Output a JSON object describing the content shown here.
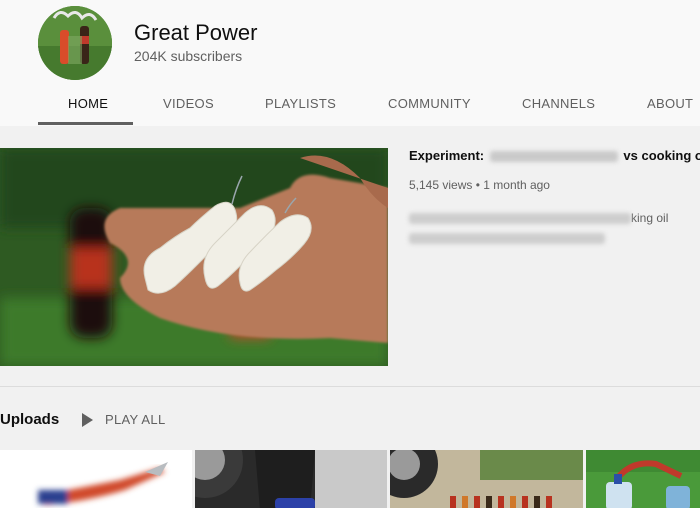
{
  "channel": {
    "name": "Great Power",
    "subscribers": "204K subscribers"
  },
  "tabs": [
    "HOME",
    "VIDEOS",
    "PLAYLISTS",
    "COMMUNITY",
    "CHANNELS",
    "ABOUT"
  ],
  "active_tab": "HOME",
  "featured": {
    "title_start": "Experiment:",
    "title_end": "vs cooking oil",
    "views": "5,145 views",
    "age": "1 month ago",
    "separator": "•",
    "desc_fragment": "king oil"
  },
  "uploads": {
    "heading": "Uploads",
    "play_all_label": "PLAY ALL"
  },
  "icons": {
    "play": "play-icon"
  },
  "colors": {
    "background": "#f9f9f9",
    "content_background": "#f1f1f1",
    "text_primary": "#0f0f0f",
    "text_secondary": "#606060"
  }
}
